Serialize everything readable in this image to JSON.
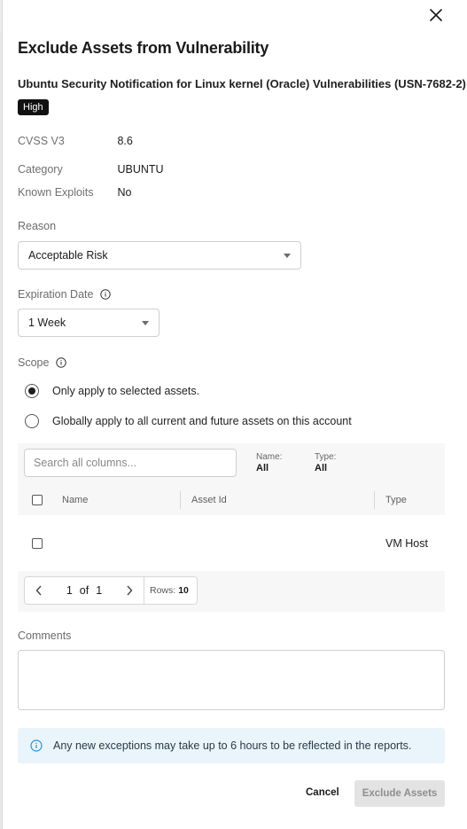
{
  "modal": {
    "title": "Exclude Assets from Vulnerability",
    "vulnerability_name": "Ubuntu Security Notification for Linux kernel (Oracle) Vulnerabilities (USN-7682-2)",
    "severity_badge": "High",
    "details": [
      {
        "label": "CVSS V3",
        "value": "8.6"
      },
      {
        "label": "Category",
        "value": "UBUNTU"
      },
      {
        "label": "Known Exploits",
        "value": "No"
      }
    ]
  },
  "reason": {
    "label": "Reason",
    "selected": "Acceptable Risk"
  },
  "expiration": {
    "label": "Expiration Date",
    "selected": "1 Week"
  },
  "scope": {
    "label": "Scope",
    "options": [
      {
        "label": "Only apply to selected assets.",
        "selected": true
      },
      {
        "label": "Globally apply to all current and future assets on this account",
        "selected": false
      }
    ]
  },
  "table": {
    "search_placeholder": "Search all columns...",
    "filters": [
      {
        "label": "Name:",
        "value": "All"
      },
      {
        "label": "Type:",
        "value": "All"
      }
    ],
    "columns": [
      "Name",
      "Asset Id",
      "Type"
    ],
    "rows": [
      {
        "name": "",
        "asset_id": "",
        "type": "VM Host"
      }
    ],
    "pagination": {
      "current": "1",
      "of_label": "of",
      "total": "1",
      "rows_label": "Rows:",
      "rows_value": "10"
    }
  },
  "comments": {
    "label": "Comments",
    "value": ""
  },
  "notice": {
    "text": "Any new exceptions may take up to 6 hours to be reflected in the reports."
  },
  "footer": {
    "cancel_label": "Cancel",
    "submit_label": "Exclude Assets"
  }
}
